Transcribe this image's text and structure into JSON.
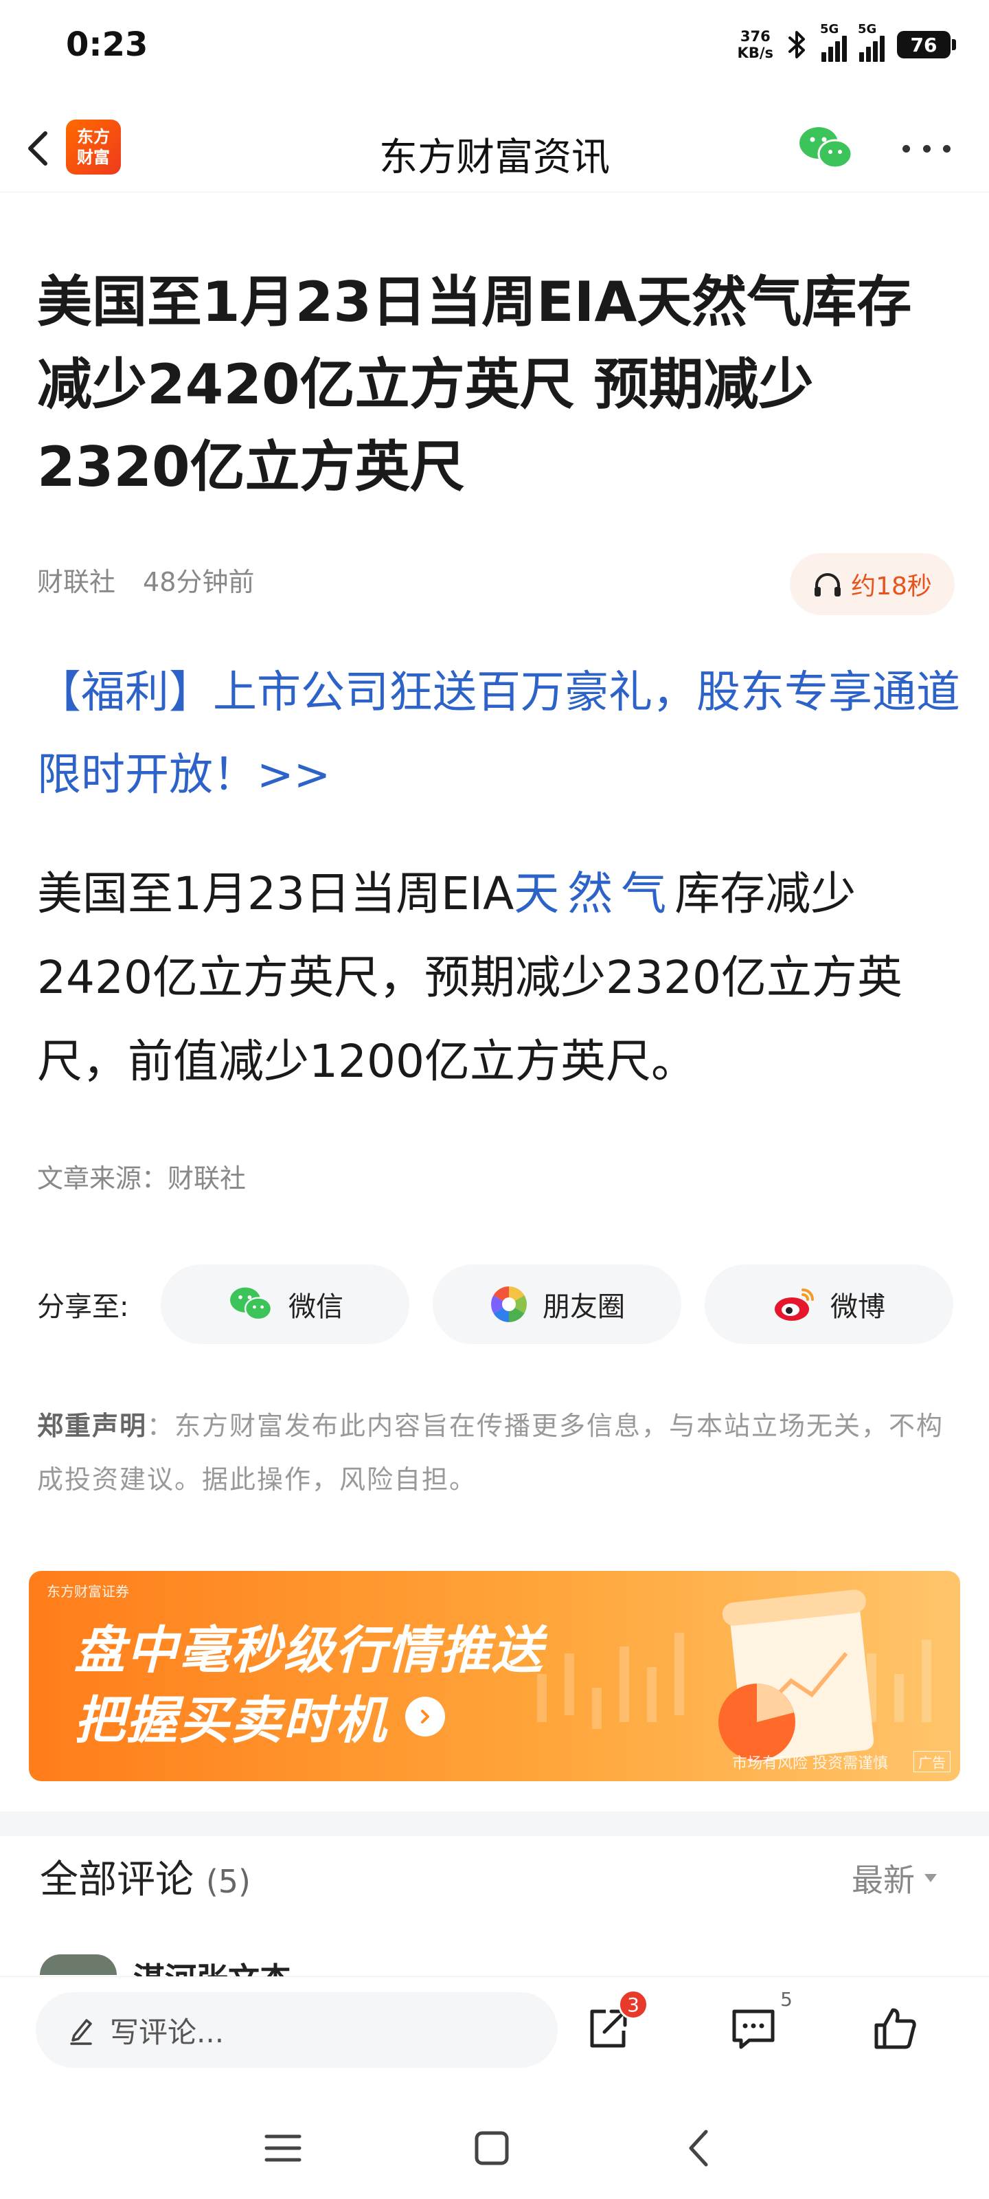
{
  "status_bar": {
    "time": "0:23",
    "net_speed_value": "376",
    "net_speed_unit": "KB/s",
    "sim1_tag": "5G",
    "sim2_tag": "5G",
    "battery": "76"
  },
  "navbar": {
    "logo_line1": "东方",
    "logo_line2": "财富",
    "title": "东方财富资讯"
  },
  "article": {
    "title": "美国至1月23日当周EIA天然气库存减少2420亿立方英尺 预期减少2320亿立方英尺",
    "source": "财联社",
    "time_ago": "48分钟前",
    "listen_label": "约18秒",
    "promo_link": "【福利】上市公司狂送百万豪礼，股东专享通道限时开放！>>",
    "body_prefix": "美国至1月23日当周EIA",
    "body_keyword": "天然气",
    "body_suffix": "库存减少2420亿立方英尺，预期减少2320亿立方英尺，前值减少1200亿立方英尺。",
    "article_source_line": "文章来源：财联社"
  },
  "share": {
    "label": "分享至:",
    "buttons": [
      {
        "label": "微信",
        "icon": "wechat-icon"
      },
      {
        "label": "朋友圈",
        "icon": "moments-icon"
      },
      {
        "label": "微博",
        "icon": "weibo-icon"
      }
    ]
  },
  "disclaimer": {
    "title": "郑重声明",
    "text": "：东方财富发布此内容旨在传播更多信息，与本站立场无关，不构成投资建议。据此操作，风险自担。"
  },
  "banner": {
    "brand": "东方财富证券",
    "line1": "盘中毫秒级行情推送",
    "line2": "把握买卖时机",
    "risk_note": "市场有风险 投资需谨慎",
    "ad_tag": "广告"
  },
  "comments": {
    "title": "全部评论",
    "count": "(5)",
    "sort_label": "最新",
    "first_commenter": "湛河张文杰"
  },
  "bottom_bar": {
    "input_placeholder": "写评论...",
    "share_badge": "3",
    "comment_count": "5"
  },
  "colors": {
    "accent_blue": "#2d63c8",
    "brand_orange": "#ff6a00",
    "badge_red": "#e8392b"
  }
}
